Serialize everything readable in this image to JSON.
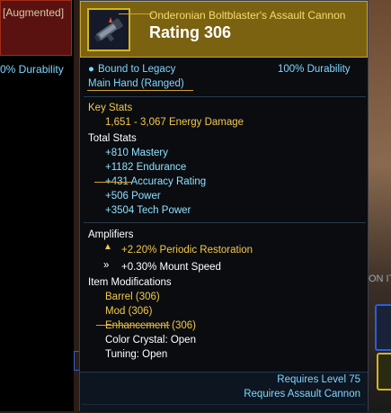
{
  "background": {
    "left_header": "[Augmented]",
    "left_durability": "0% Durability",
    "right_partial": "ON IT"
  },
  "item": {
    "name": "Onderonian Boltblaster's Assault Cannon",
    "rating": "Rating 306",
    "bound": "Bound to Legacy",
    "durability": "100% Durability",
    "slot": "Main Hand (Ranged)",
    "key_stats_label": "Key Stats",
    "damage": "1,651 - 3,067 Energy Damage",
    "total_stats_label": "Total Stats",
    "stats": [
      "+810 Mastery",
      "+1182 Endurance",
      "+431 Accuracy Rating",
      "+506 Power",
      "+3504 Tech Power"
    ],
    "amplifiers_label": "Amplifiers",
    "amplifiers": [
      "+2.20% Periodic Restoration",
      "+0.30% Mount Speed"
    ],
    "mods_label": "Item Modifications",
    "mods": [
      "Barrel (306)",
      "Mod (306)",
      "Enhancement (306)"
    ],
    "color_crystal": "Color Crystal: Open",
    "tuning": "Tuning: Open",
    "req_level": "Requires Level 75",
    "req_skill": "Requires Assault Cannon"
  },
  "colors": {
    "header_gold": "#7a6210",
    "accent_gold": "#f4c94a",
    "stat_blue": "#8fe0ff"
  }
}
